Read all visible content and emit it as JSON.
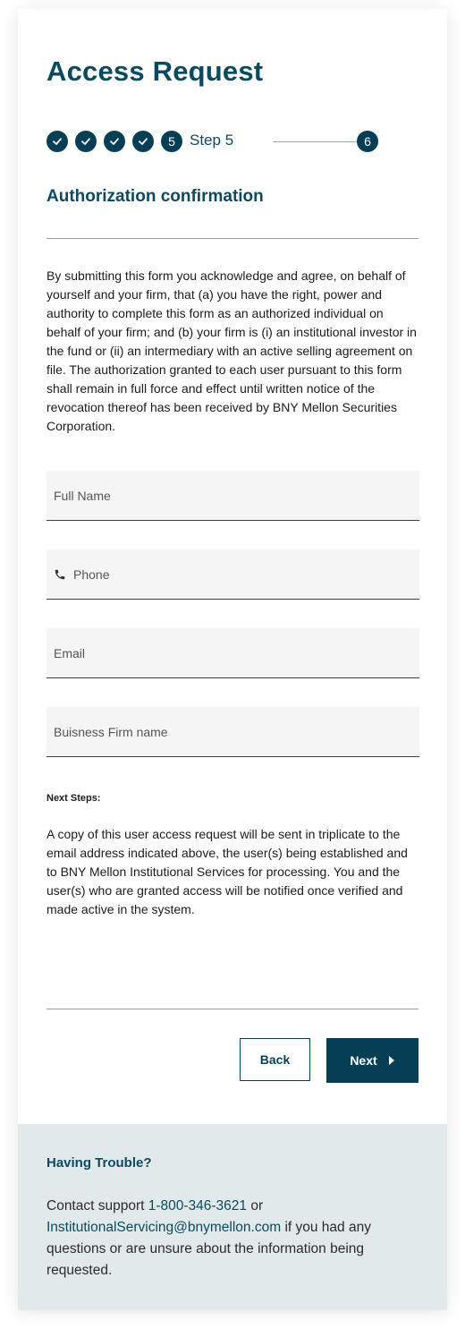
{
  "page": {
    "title": "Access Request",
    "subtitle": "Authorization confirmation"
  },
  "stepper": {
    "completed_steps": [
      1,
      2,
      3,
      4
    ],
    "current_step_number": "5",
    "current_step_label": "Step 5",
    "next_step_number": "6"
  },
  "legal_text": "By submitting this form you acknowledge and agree, on behalf of yourself and your firm, that (a) you have the right, power and authority to complete this form as an authorized individual on behalf of your firm; and (b) your firm is (i) an institutional investor in the fund or (ii) an intermediary with an active selling agreement on file. The authorization granted to each user pursuant to this form shall remain in full force and effect until written notice of the revocation thereof has been received by BNY Mellon Securities Corporation.",
  "fields": {
    "full_name": {
      "placeholder": "Full Name",
      "value": ""
    },
    "phone": {
      "placeholder": "Phone",
      "value": "",
      "icon": "phone-icon"
    },
    "email": {
      "placeholder": "Email",
      "value": ""
    },
    "firm": {
      "placeholder": "Buisness Firm name",
      "value": ""
    }
  },
  "next_steps": {
    "heading": "Next Steps:",
    "text": "A copy of this user access request will be sent in triplicate to the email address indicated above, the user(s) being established and to BNY Mellon Institutional Services for processing. You and the user(s) who are granted access will be notified once verified and made active in the system."
  },
  "buttons": {
    "back_label": "Back",
    "next_label": "Next"
  },
  "help": {
    "title": "Having Trouble?",
    "prefix": "Contact support ",
    "phone": "1-800-346-3621",
    "middle": " or",
    "email": "InstitutionalServicing@bnymellon.com",
    "suffix": " if you had any questions or are unsure about the information being requested."
  },
  "colors": {
    "primary": "#063f55",
    "heading": "#0b4a5f",
    "help_background": "#e2e9ea",
    "field_background": "#f5f5f5"
  }
}
